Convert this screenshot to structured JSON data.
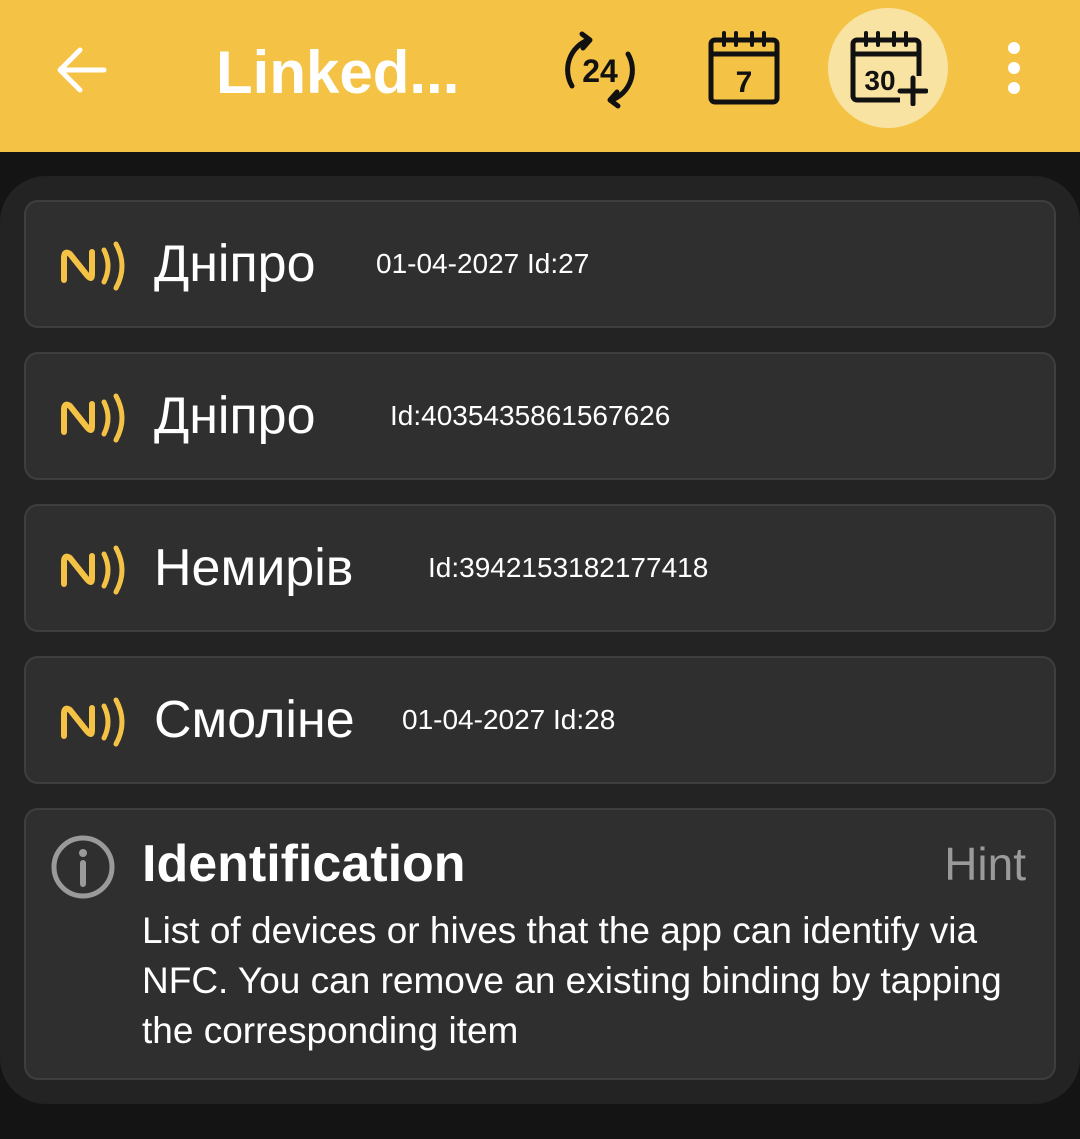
{
  "appbar": {
    "title": "Linked...",
    "back_icon": "arrow-left-icon",
    "filter_24h_label": "24",
    "filter_7d_label": "7",
    "filter_30d_label": "30",
    "selected_filter": "30",
    "more_icon": "more-vert-icon"
  },
  "colors": {
    "accent": "#F4C244",
    "accent_light": "#F9E3A3",
    "panel": "#232323",
    "card": "#2F2F2F",
    "hint_grey": "#9A9A9A"
  },
  "tags": [
    {
      "name": "Дніпро",
      "meta": "01-04-2027 Id:27",
      "icon": "nfc-icon"
    },
    {
      "name": "Дніпро",
      "meta": "Id:4035435861567626",
      "icon": "nfc-icon"
    },
    {
      "name": "Немирів",
      "meta": "Id:3942153182177418",
      "icon": "nfc-icon"
    },
    {
      "name": "Смоліне",
      "meta": "01-04-2027 Id:28",
      "icon": "nfc-icon"
    }
  ],
  "hint": {
    "icon": "info-icon",
    "title": "Identification",
    "label": "Hint",
    "text": "List of devices or hives that the app can identify via NFC. You can remove an existing binding by tapping the corresponding item"
  }
}
